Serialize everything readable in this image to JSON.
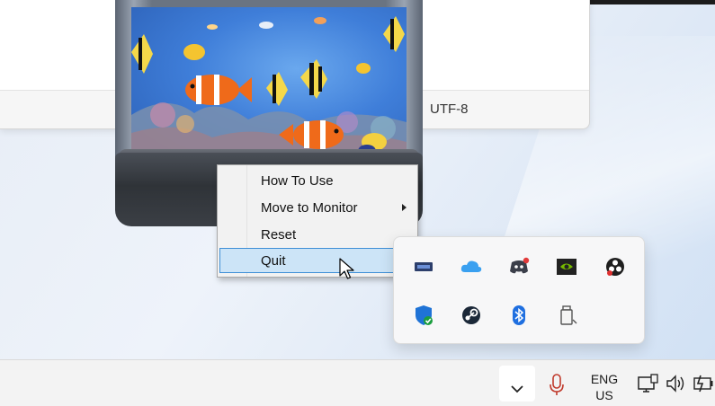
{
  "background_window": {
    "status_encoding": "UTF-8"
  },
  "context_menu": {
    "items": [
      {
        "label": "How To Use",
        "has_submenu": false,
        "highlighted": false
      },
      {
        "label": "Move to Monitor",
        "has_submenu": true,
        "highlighted": false
      },
      {
        "label": "Reset",
        "has_submenu": false,
        "highlighted": false
      },
      {
        "label": "Quit",
        "has_submenu": false,
        "highlighted": true
      }
    ]
  },
  "tray_flyout": {
    "icons": [
      "network-adapter-icon",
      "onedrive-cloud-icon",
      "discord-icon",
      "nvidia-icon",
      "obs-icon",
      "windows-security-icon",
      "steam-icon",
      "bluetooth-icon",
      "usb-safely-remove-icon"
    ]
  },
  "taskbar": {
    "language_line1": "ENG",
    "language_line2": "US",
    "icons": [
      "chevron-up-icon",
      "microphone-icon",
      "display-network-icon",
      "speaker-icon",
      "battery-charging-icon"
    ]
  },
  "colors": {
    "menu_highlight": "#cce4f7",
    "menu_highlight_border": "#3f8fd6",
    "mic_accent": "#c0392b"
  }
}
